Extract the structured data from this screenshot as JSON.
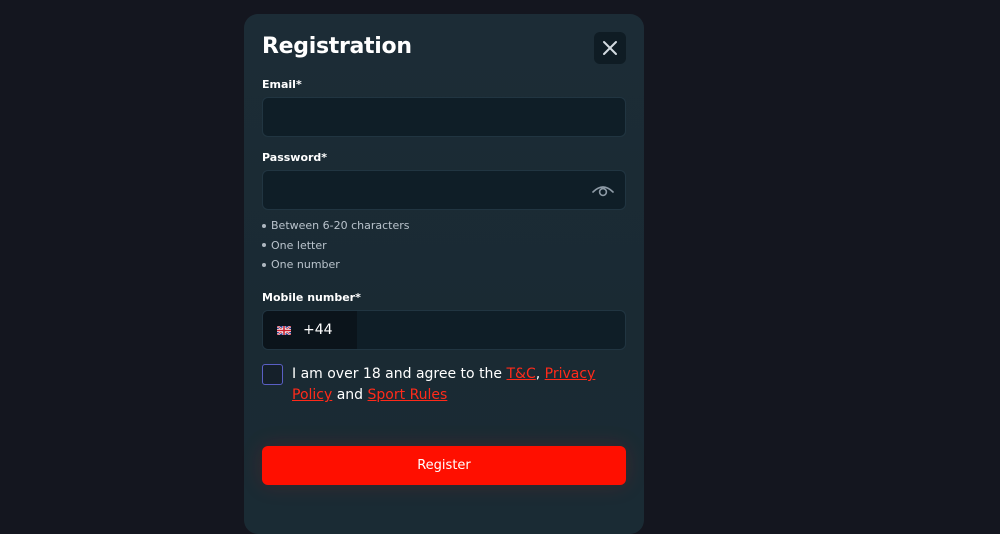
{
  "modal": {
    "title": "Registration",
    "close_icon": "close-icon"
  },
  "email": {
    "label": "Email*",
    "value": "",
    "placeholder": ""
  },
  "password": {
    "label": "Password*",
    "value": "",
    "placeholder": "",
    "toggle_icon": "eye-icon",
    "rules": [
      "Between 6-20 characters",
      "One letter",
      "One number"
    ]
  },
  "mobile": {
    "label": "Mobile number*",
    "flag_icon": "uk-flag-icon",
    "country_code": "+44",
    "value": ""
  },
  "agreement": {
    "checked": false,
    "prefix": "I am over 18 and agree to the ",
    "tc_link": "T&C",
    "comma": ",",
    "privacy_link": "Privacy Policy",
    "and": " and ",
    "sport_rules_link": "Sport Rules"
  },
  "register_label": "Register",
  "colors": {
    "background": "#14161f",
    "panel": "#1c2c36",
    "input": "#0f1e27",
    "accent": "#ff0f00",
    "link": "#ff2a1a",
    "checkbox_border": "#5a5fc4"
  }
}
